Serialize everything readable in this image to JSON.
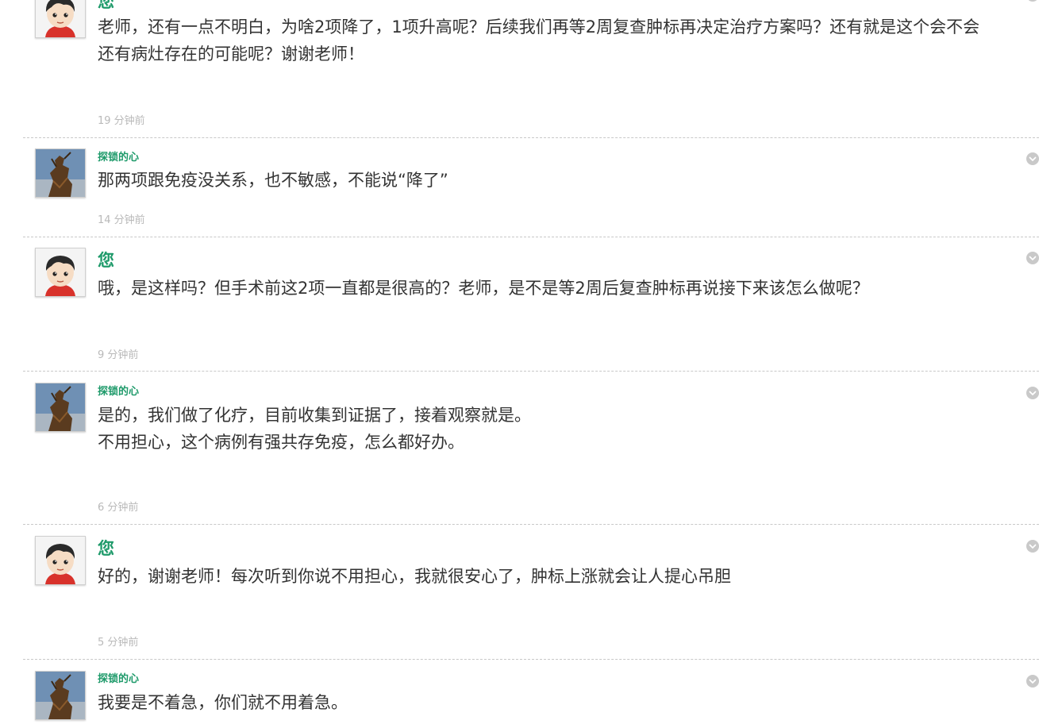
{
  "messages": [
    {
      "role": "patient",
      "author": "您",
      "lines": [
        "老师，还有一点不明白，为啥2项降了，1项升高呢？后续我们再等2周复查肿标再决定治疗方案吗？还有就是这个会不会",
        "还有病灶存在的可能呢？谢谢老师！"
      ],
      "time": "19 分钟前"
    },
    {
      "role": "doctor",
      "author": "探锁的心",
      "lines": [
        "那两项跟免疫没关系，也不敏感，不能说“降了”"
      ],
      "time": "14 分钟前"
    },
    {
      "role": "patient",
      "author": "您",
      "lines": [
        "哦，是这样吗？但手术前这2项一直都是很高的？老师，是不是等2周后复查肿标再说接下来该怎么做呢？"
      ],
      "time": "9 分钟前"
    },
    {
      "role": "doctor",
      "author": "探锁的心",
      "lines": [
        "是的，我们做了化疗，目前收集到证据了，接着观察就是。",
        "不用担心，这个病例有强共存免疫，怎么都好办。"
      ],
      "time": "6 分钟前"
    },
    {
      "role": "patient",
      "author": "您",
      "lines": [
        "好的，谢谢老师！每次听到你说不用担心，我就很安心了，肿标上涨就会让人提心吊胆"
      ],
      "time": "5 分钟前"
    },
    {
      "role": "doctor",
      "author": "探锁的心",
      "lines": [
        "我要是不着急，你们就不用着急。"
      ],
      "time": ""
    }
  ],
  "icons": {
    "patient_avatar": "cartoon-boy-avatar-icon",
    "doctor_avatar": "statue-photo-avatar-icon",
    "menu_toggle": "chevron-down-circle-icon"
  },
  "colors": {
    "author": "#1e9a6a",
    "body_text": "#333333",
    "timestamp": "#b9b9b9",
    "divider": "#c8c8c8",
    "menu_toggle": "#c9c9c9"
  }
}
